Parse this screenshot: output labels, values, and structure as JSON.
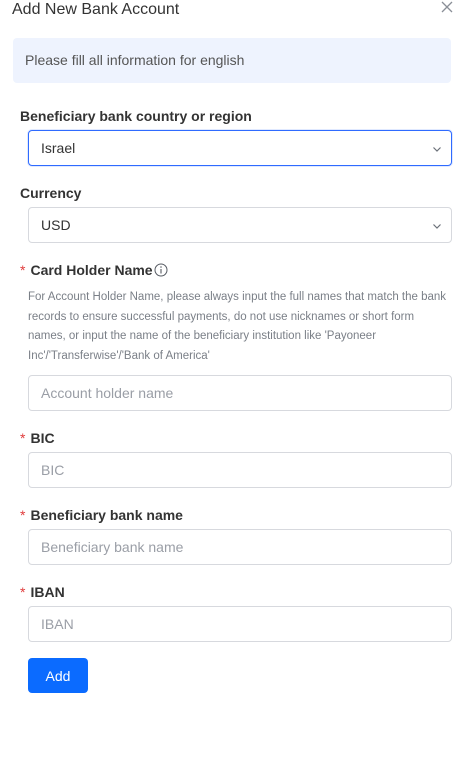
{
  "dialog": {
    "title": "Add New Bank Account",
    "notice": "Please fill all information for english"
  },
  "form": {
    "country": {
      "label": "Beneficiary bank country or region",
      "value": "Israel"
    },
    "currency": {
      "label": "Currency",
      "value": "USD"
    },
    "card_holder": {
      "required_mark": "*",
      "label": "Card Holder Name",
      "helper": "For Account Holder Name, please always input the full names that match the bank records to ensure successful payments, do not use nicknames or short form names, or input the name of the beneficiary institution like 'Payoneer Inc'/'Transferwise'/'Bank of America'",
      "placeholder": "Account holder name"
    },
    "bic": {
      "required_mark": "*",
      "label": "BIC",
      "placeholder": "BIC"
    },
    "bank_name": {
      "required_mark": "*",
      "label": "Beneficiary bank name",
      "placeholder": "Beneficiary bank name"
    },
    "iban": {
      "required_mark": "*",
      "label": "IBAN",
      "placeholder": "IBAN"
    },
    "submit_label": "Add"
  },
  "icons": {
    "close": "close-icon",
    "chevron": "chevron-down-icon",
    "info": "info-circle-icon"
  },
  "colors": {
    "primary": "#0b6bff",
    "focus_border": "#2f6bff",
    "notice_bg": "#eef3fe",
    "required": "#e03b3b"
  }
}
